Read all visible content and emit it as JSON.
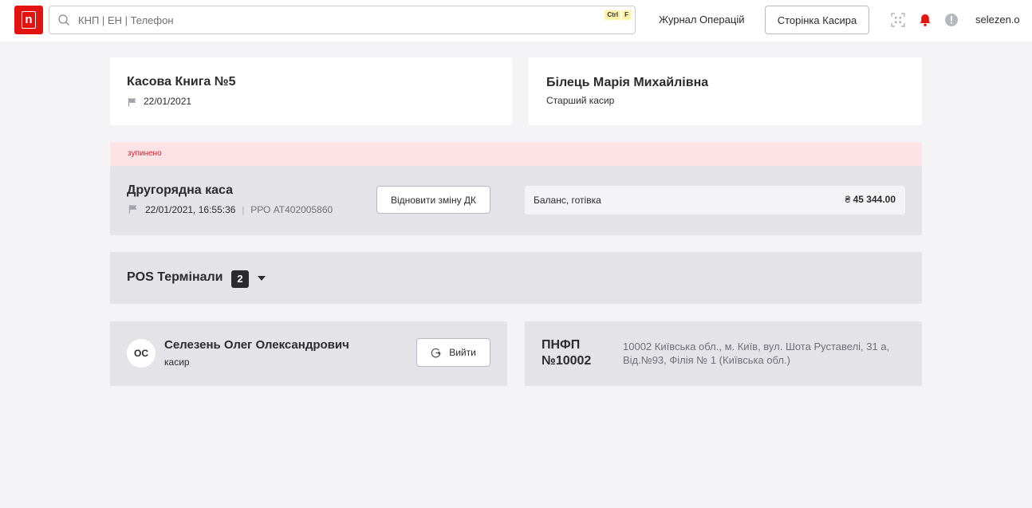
{
  "header": {
    "logo_letter": "n",
    "search": {
      "placeholder": "КНП | ЕН | Телефон",
      "value": "",
      "hotkeys": [
        "Ctrl",
        "F"
      ]
    },
    "journal_link": "Журнал Операцій",
    "cashier_page_button": "Сторінка Касира",
    "icons": [
      "qr-scan-icon",
      "bell-icon",
      "alert-icon"
    ],
    "username": "selezen.o"
  },
  "cash_book": {
    "title": "Касова Книга №5",
    "date": "22/01/2021"
  },
  "senior_cashier": {
    "name": "Білець Марія Михайлівна",
    "role": "Старший касир"
  },
  "register": {
    "status": "зупинено",
    "title": "Другорядна каса",
    "datetime": "22/01/2021, 16:55:36",
    "rro": "РРО АТ402005860",
    "restore_button": "Відновити зміну ДК",
    "balance_label": "Баланс, готівка",
    "currency": "₴",
    "balance_value": "45 344.00"
  },
  "pos": {
    "title": "POS Термінали",
    "count": "2"
  },
  "user": {
    "initials": "ОС",
    "name": "Селезень Олег Олександрович",
    "role": "касир",
    "logout_button": "Вийти"
  },
  "branch": {
    "code": "ПНФП №10002",
    "address": "10002 Київська обл., м. Київ, вул. Шота Руставелі, 31 а, Від.№93, Філія № 1 (Київська обл.)"
  },
  "colors": {
    "brand": "#e3140f",
    "status_bg": "#fde3e5",
    "status_text": "#d0202a",
    "bell": "#e3140f"
  }
}
